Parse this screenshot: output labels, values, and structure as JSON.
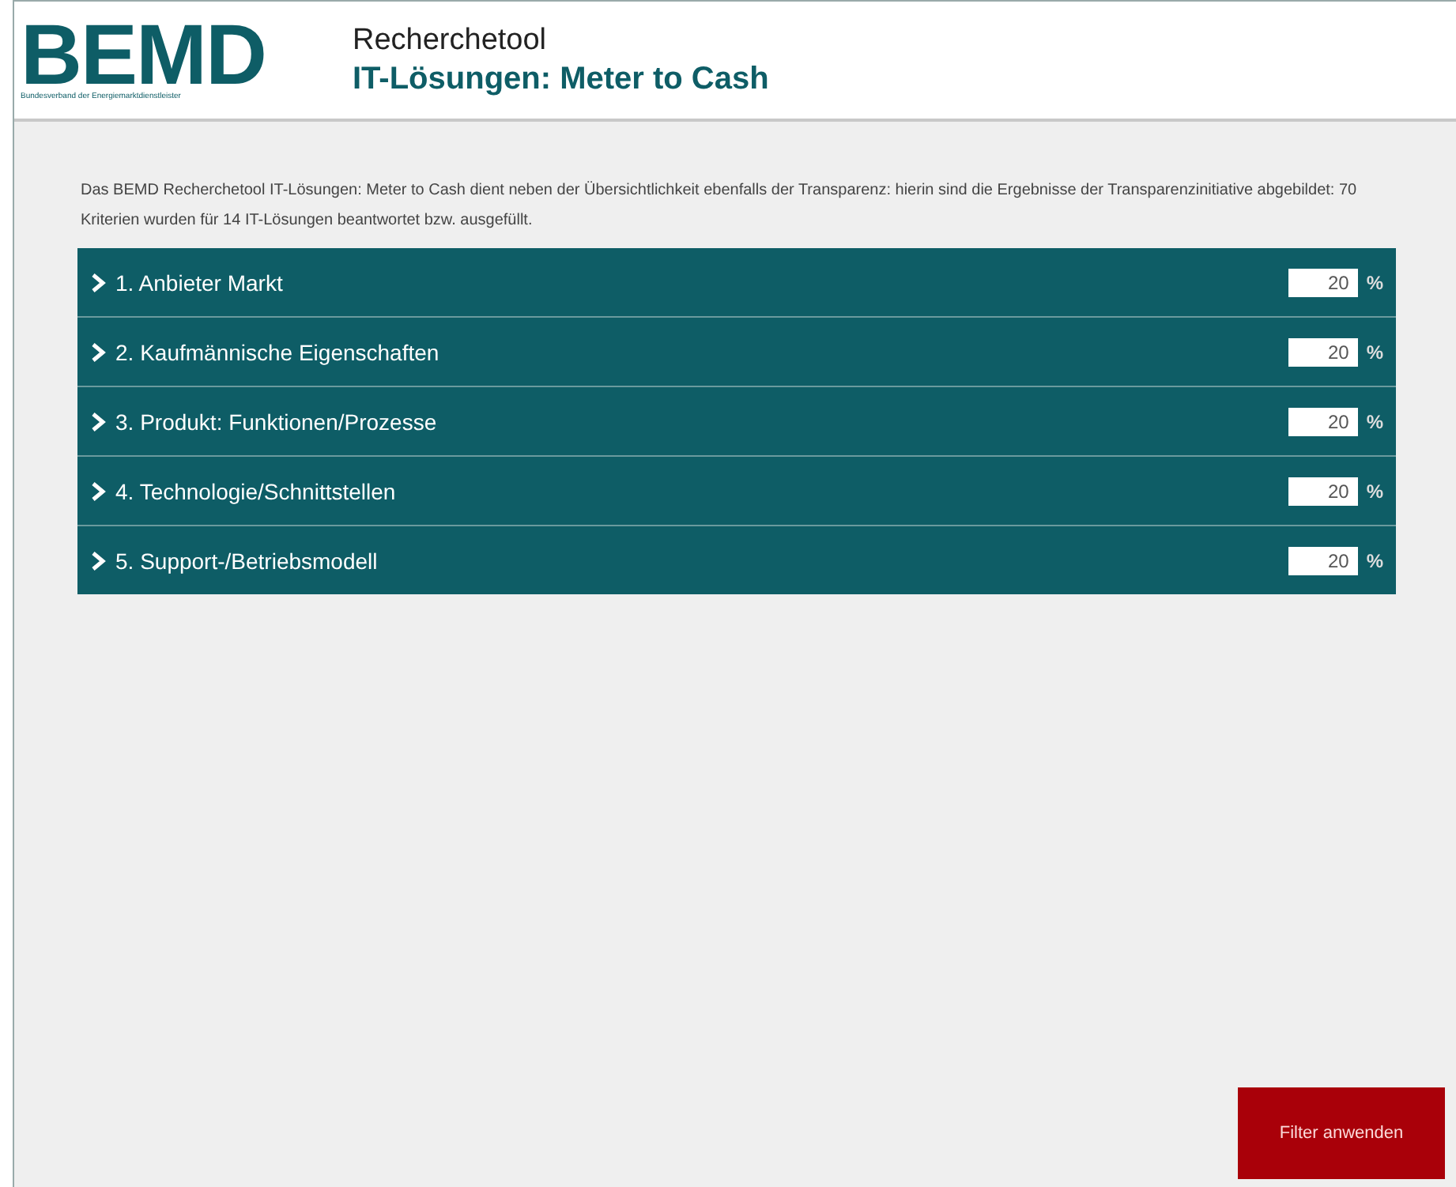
{
  "header": {
    "logo": {
      "text": "BEMD",
      "subtitle": "Bundesverband der Energiemarktdienstleister"
    },
    "title": "Recherchetool",
    "subtitle": "IT-Lösungen: Meter to Cash"
  },
  "intro": "Das BEMD Recherchetool IT-Lösungen: Meter to Cash dient neben der Übersichtlichkeit ebenfalls der Transparenz: hierin sind die Ergebnisse der Transparenzinitiative abgebildet: 70 Kriterien wurden für 14 IT-Lösungen beantwortet bzw. ausgefüllt.",
  "sections": [
    {
      "label": "1. Anbieter Markt",
      "value": "20",
      "unit": "%",
      "expanded": false
    },
    {
      "label": "2. Kaufmännische Eigenschaften",
      "value": "20",
      "unit": "%",
      "expanded": false
    },
    {
      "label": "3. Produkt: Funktionen/Prozesse",
      "value": "20",
      "unit": "%",
      "expanded": false
    },
    {
      "label": "4. Technologie/Schnittstellen",
      "value": "20",
      "unit": "%",
      "expanded": false
    },
    {
      "label": "5. Support-/Betriebsmodell",
      "value": "20",
      "unit": "%",
      "expanded": false
    }
  ],
  "button": "Filter anwenden"
}
